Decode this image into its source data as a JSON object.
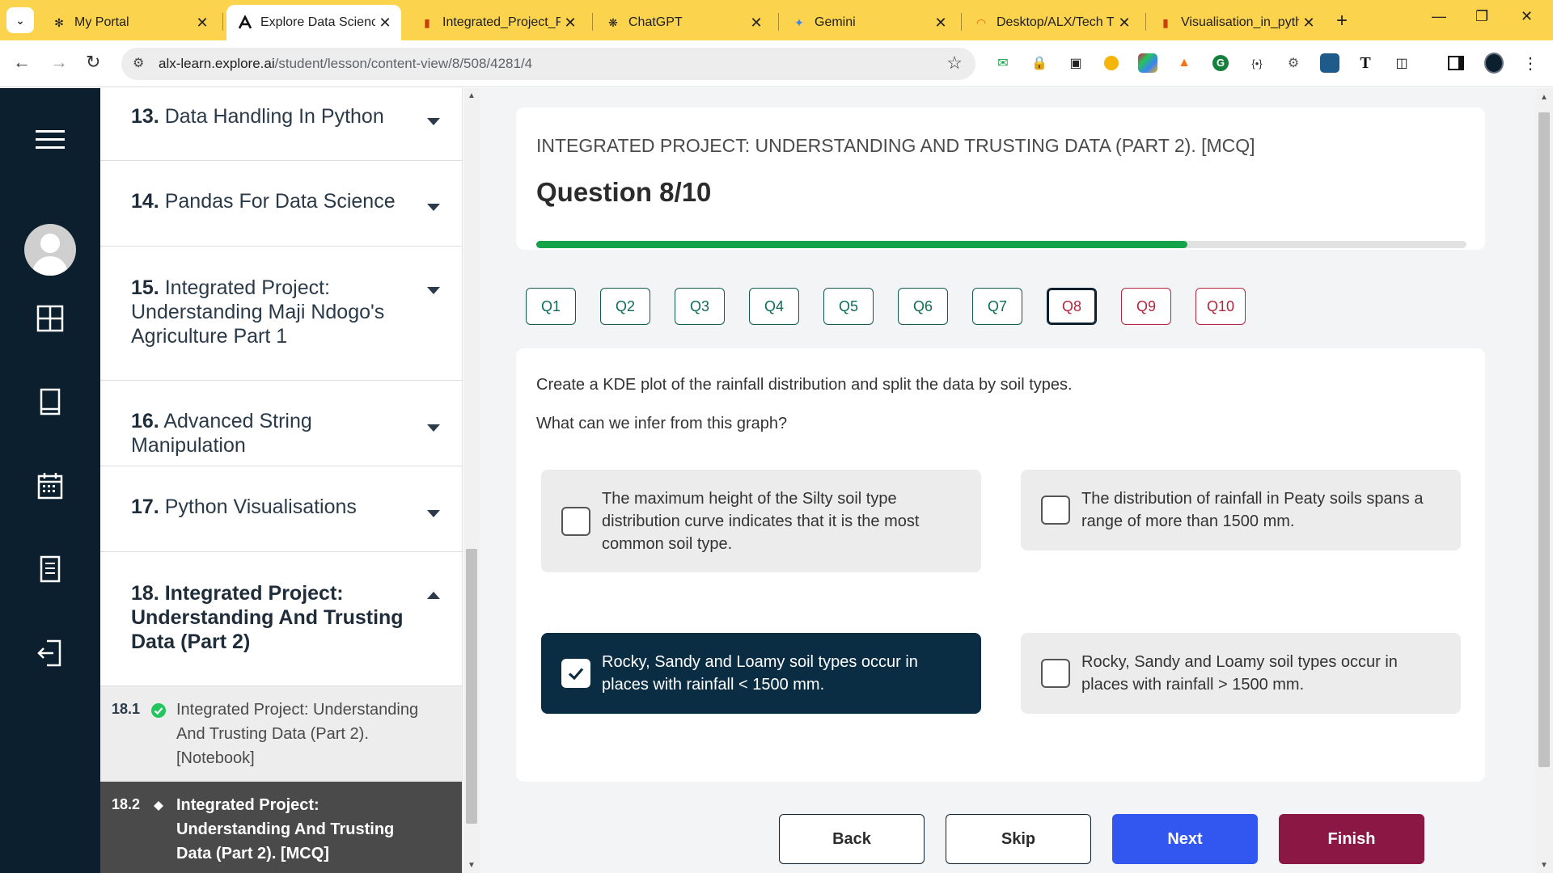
{
  "browser": {
    "tabs": [
      {
        "title": "My Portal",
        "favicon": "portal-icon"
      },
      {
        "title": "Explore Data Science",
        "favicon": "explore-logo-icon"
      },
      {
        "title": "Integrated_Project_P",
        "favicon": "notebook-icon"
      },
      {
        "title": "ChatGPT",
        "favicon": "chatgpt-icon"
      },
      {
        "title": "Gemini",
        "favicon": "gemini-icon"
      },
      {
        "title": "Desktop/ALX/Tech Tr",
        "favicon": "jupyter-icon"
      },
      {
        "title": "Visualisation_in_pyth",
        "favicon": "notebook-icon"
      }
    ],
    "url_host": "alx-learn.explore.ai",
    "url_path": "/student/lesson/content-view/8/508/4281/4"
  },
  "outline": {
    "modules": [
      {
        "num": "13.",
        "title": "Data Handling In Python"
      },
      {
        "num": "14.",
        "title": "Pandas For Data Science"
      },
      {
        "num": "15.",
        "title": "Integrated Project: Understanding Maji Ndogo's Agriculture Part 1"
      },
      {
        "num": "16.",
        "title": "Advanced String Manipulation"
      },
      {
        "num": "17.",
        "title": "Python Visualisations"
      },
      {
        "num": "18.",
        "title": "Integrated Project: Understanding And Trusting Data (Part 2)"
      }
    ],
    "lessons": [
      {
        "num": "18.1",
        "title": "Integrated Project: Understanding And Trusting Data (Part 2). [Notebook]",
        "status": "completed"
      },
      {
        "num": "18.2",
        "title": "Integrated Project: Understanding And Trusting Data (Part 2). [MCQ]",
        "status": "current"
      }
    ]
  },
  "quiz": {
    "kicker": "INTEGRATED PROJECT: UNDERSTANDING AND TRUSTING DATA (PART 2). [MCQ]",
    "question_title": "Question 8/10",
    "progress_fraction": 0.7,
    "nav": [
      "Q1",
      "Q2",
      "Q3",
      "Q4",
      "Q5",
      "Q6",
      "Q7",
      "Q8",
      "Q9",
      "Q10"
    ],
    "current_question": "Q8",
    "prompt": "Create a KDE plot of the rainfall distribution and split the data by soil types.",
    "question": "What can we infer from this graph?",
    "options": [
      {
        "text": "The maximum height of the Silty soil type distribution curve indicates that it is the most common soil type.",
        "selected": false
      },
      {
        "text": "The distribution of rainfall in Peaty soils spans a range of more than 1500 mm.",
        "selected": false
      },
      {
        "text": "Rocky, Sandy and Loamy soil types occur in places with rainfall < 1500 mm.",
        "selected": true
      },
      {
        "text": "Rocky, Sandy and Loamy soil types occur in places with rainfall > 1500 mm.",
        "selected": false
      }
    ],
    "actions": {
      "back": "Back",
      "skip": "Skip",
      "next": "Next",
      "finish": "Finish"
    }
  },
  "colors": {
    "tabbar": "#fcd34d",
    "rail": "#0b1f2e",
    "progress": "#16a34a",
    "next": "#3257f0",
    "finish": "#8a1744",
    "selected_option": "#0b2d43"
  }
}
